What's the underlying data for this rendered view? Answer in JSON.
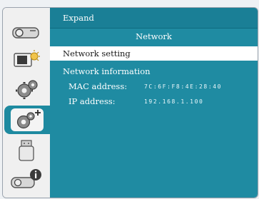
{
  "header": {
    "title": "Expand"
  },
  "section": {
    "title": "Network"
  },
  "menu": {
    "selected_item": "Network setting"
  },
  "info": {
    "title": "Network information",
    "rows": [
      {
        "label": "MAC address:",
        "value": "7C:6F:F8:4E:28:40"
      },
      {
        "label": "IP address:",
        "value": "192.168.1.100"
      }
    ]
  },
  "sidebar": {
    "items": [
      {
        "icon": "projector-icon"
      },
      {
        "icon": "display-sun-icon"
      },
      {
        "icon": "gear-icon"
      },
      {
        "icon": "gear-plus-icon",
        "active": true
      },
      {
        "icon": "usb-icon"
      },
      {
        "icon": "projector-info-icon"
      }
    ]
  },
  "colors": {
    "panel": "#1f8ba2",
    "active": "#1e8aa0",
    "highlight": "#ffffff"
  }
}
